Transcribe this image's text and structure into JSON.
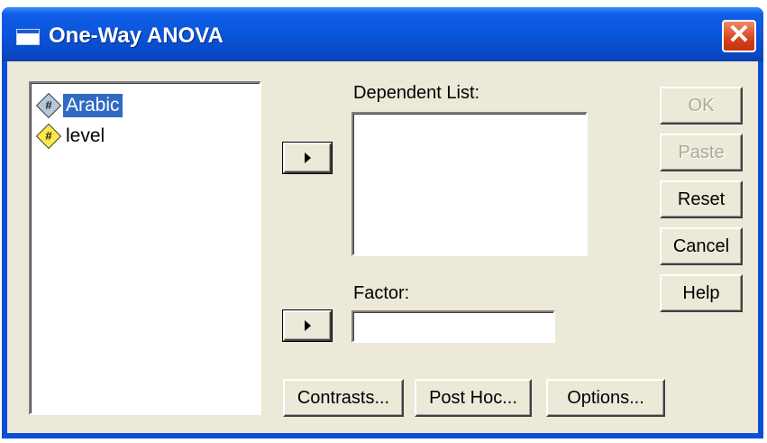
{
  "window": {
    "title": "One-Way ANOVA",
    "close_glyph": "✕"
  },
  "variables": [
    {
      "name": "Arabic",
      "icon": "scale-variable-icon",
      "icon_glyph": "#",
      "selected": true
    },
    {
      "name": "level",
      "icon": "ordinal-variable-icon",
      "icon_glyph": "#",
      "selected": false
    }
  ],
  "dependent_list": {
    "label": "Dependent List:"
  },
  "factor": {
    "label": "Factor:",
    "value": ""
  },
  "buttons": {
    "ok": "OK",
    "paste": "Paste",
    "reset": "Reset",
    "cancel": "Cancel",
    "help": "Help",
    "contrasts": "Contrasts...",
    "post_hoc": "Post Hoc...",
    "options": "Options..."
  },
  "colors": {
    "titlebar": "#0a55db",
    "dialog_bg": "#ece9d8",
    "selection": "#316ac5",
    "close_button": "#d8421a"
  }
}
